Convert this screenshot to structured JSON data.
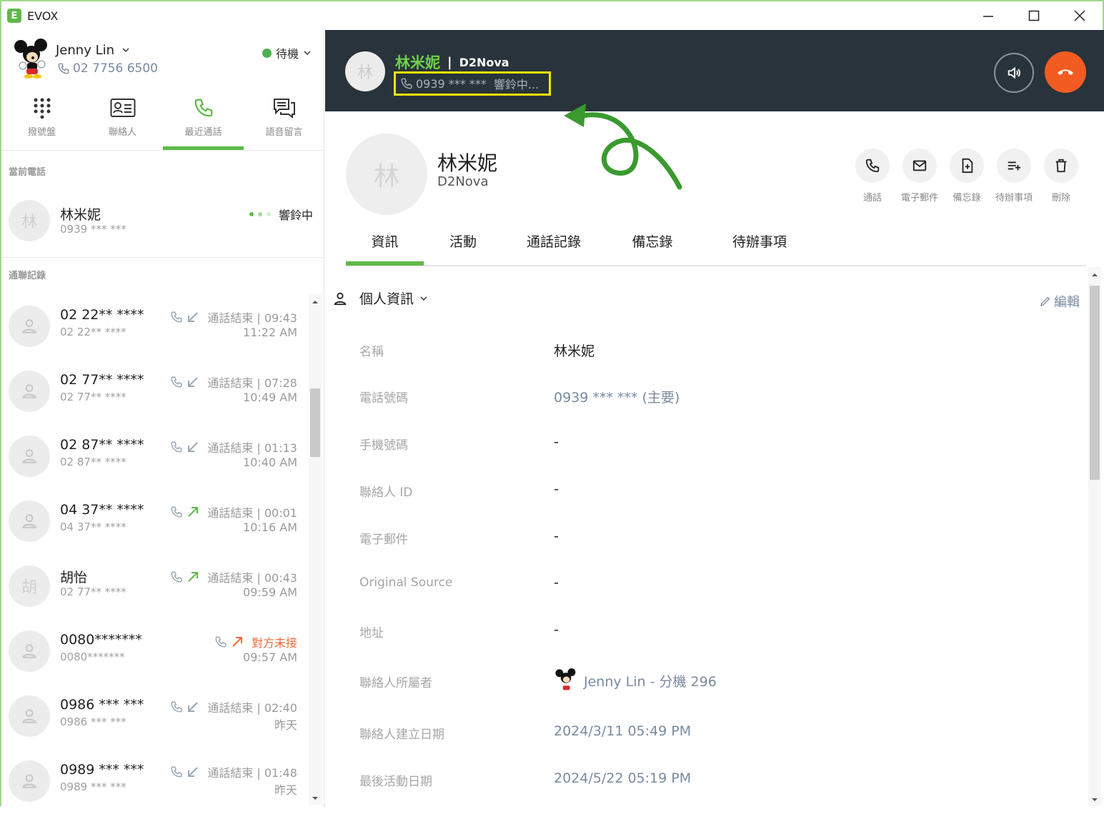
{
  "app": {
    "title": "EVOX"
  },
  "user": {
    "name": "Jenny Lin",
    "ext": "02 7756 6500",
    "status": "待機"
  },
  "nav": {
    "tabs": [
      {
        "label": "撥號盤"
      },
      {
        "label": "聯絡人"
      },
      {
        "label": "最近通話"
      },
      {
        "label": "語音留言"
      }
    ]
  },
  "sidebar": {
    "current_title": "當前電話",
    "current": {
      "avatar": "林",
      "name": "林米妮",
      "number": "0939 *** ***",
      "status": "響鈴中"
    },
    "history_title": "通聯記錄",
    "history": [
      {
        "avatar": "",
        "name": "02 22** ****",
        "number": "02 22** ****",
        "status": "通話結束 | 09:43",
        "time": "11:22 AM",
        "dir": "in"
      },
      {
        "avatar": "",
        "name": "02 77** ****",
        "number": "02 77** ****",
        "status": "通話結束 | 07:28",
        "time": "10:49 AM",
        "dir": "in"
      },
      {
        "avatar": "",
        "name": "02 87** ****",
        "number": "02 87** ****",
        "status": "通話結束 | 01:13",
        "time": "10:40 AM",
        "dir": "in"
      },
      {
        "avatar": "",
        "name": "04 37** ****",
        "number": "04 37** ****",
        "status": "通話結束 | 00:01",
        "time": "10:16 AM",
        "dir": "out"
      },
      {
        "avatar": "胡",
        "name": "胡怡",
        "number": "02 77** ****",
        "status": "通話結束 | 00:43",
        "time": "09:59 AM",
        "dir": "out"
      },
      {
        "avatar": "",
        "name": "0080*******",
        "number": "0080*******",
        "status": "對方未接",
        "time": "09:57 AM",
        "dir": "missed"
      },
      {
        "avatar": "",
        "name": "0986 *** ***",
        "number": "0986 *** ***",
        "status": "通話結束 | 02:40",
        "time": "昨天",
        "dir": "in"
      },
      {
        "avatar": "",
        "name": "0989 *** ***",
        "number": "0989 *** ***",
        "status": "通話結束 | 01:48",
        "time": "昨天",
        "dir": "in"
      }
    ]
  },
  "callbar": {
    "avatar": "林",
    "name": "林米妮",
    "sep": "|",
    "company": "D2Nova",
    "number": "0939 *** ***",
    "status": "響鈴中..."
  },
  "contact": {
    "avatar": "林",
    "name": "林米妮",
    "company": "D2Nova"
  },
  "actions": [
    {
      "label": "通話",
      "icon": "phone-icon"
    },
    {
      "label": "電子郵件",
      "icon": "mail-icon"
    },
    {
      "label": "備忘錄",
      "icon": "note-icon"
    },
    {
      "label": "待辦事項",
      "icon": "todo-icon"
    },
    {
      "label": "刪除",
      "icon": "trash-icon"
    }
  ],
  "tabs": [
    {
      "label": "資訊"
    },
    {
      "label": "活動"
    },
    {
      "label": "通話記錄"
    },
    {
      "label": "備忘錄"
    },
    {
      "label": "待辦事項"
    }
  ],
  "info": {
    "section": "個人資訊",
    "edit": "編輯",
    "fields": [
      {
        "label": "名稱",
        "value": "林米妮"
      },
      {
        "label": "電話號碼",
        "value": "0939 *** *** (主要)"
      },
      {
        "label": "手機號碼",
        "value": "-"
      },
      {
        "label": "聯絡人 ID",
        "value": "-"
      },
      {
        "label": "電子郵件",
        "value": "-"
      },
      {
        "label": "Original Source",
        "value": "-"
      },
      {
        "label": "地址",
        "value": "-"
      },
      {
        "label": "聯絡人所屬者",
        "value": "Jenny Lin - 分機 296"
      },
      {
        "label": "聯絡人建立日期",
        "value": "2024/3/11 05:49 PM"
      },
      {
        "label": "最後活動日期",
        "value": "2024/5/22 05:19 PM"
      }
    ]
  },
  "colors": {
    "accent": "#5fb94a",
    "hangup": "#f25c22",
    "header": "#28333b",
    "highlight": "#f3e600"
  }
}
